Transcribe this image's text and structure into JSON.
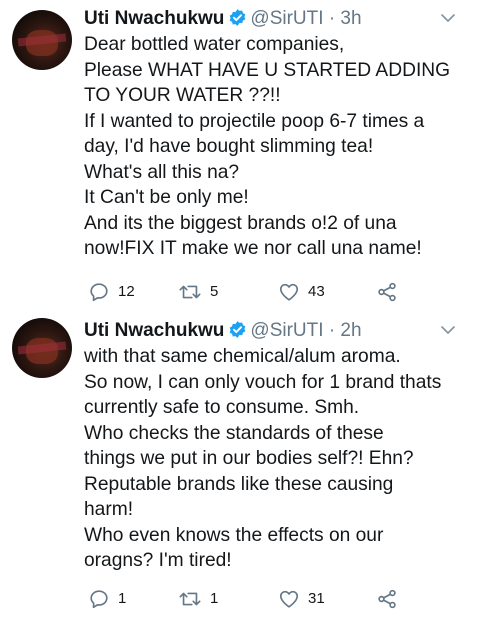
{
  "tweets": [
    {
      "name": "Uti Nwachukwu",
      "handle": "@SirUTI",
      "separator": "·",
      "time": "3h",
      "lines": [
        "Dear bottled water companies,",
        "Please WHAT HAVE U STARTED ADDING",
        "TO YOUR WATER ??!!",
        "If I wanted to projectile poop 6-7 times a",
        "day, I'd have bought slimming tea!",
        "What's all this na?",
        "It Can't be only me!",
        "And its the biggest brands o!2 of una",
        "now!FIX IT make we nor call una name!"
      ],
      "replies": "12",
      "retweets": "5",
      "likes": "43"
    },
    {
      "name": "Uti Nwachukwu",
      "handle": "@SirUTI",
      "separator": "·",
      "time": "2h",
      "lines": [
        "with that same chemical/alum aroma.",
        "So now, I can only vouch for 1 brand thats",
        "currently safe to consume. Smh.",
        "Who checks the standards of these",
        "things we put in our bodies self?! Ehn?",
        "Reputable brands like these causing",
        "harm!",
        "Who even knows the effects on our",
        "oragns? I'm tired!"
      ],
      "replies": "1",
      "retweets": "1",
      "likes": "31"
    }
  ],
  "icons": {
    "verified": "verified-badge-icon",
    "menu": "chevron-down-icon",
    "reply": "reply-icon",
    "retweet": "retweet-icon",
    "like": "heart-icon",
    "share": "share-icon"
  },
  "colors": {
    "verified": "#1da1f2",
    "secondary_text": "#657786"
  }
}
